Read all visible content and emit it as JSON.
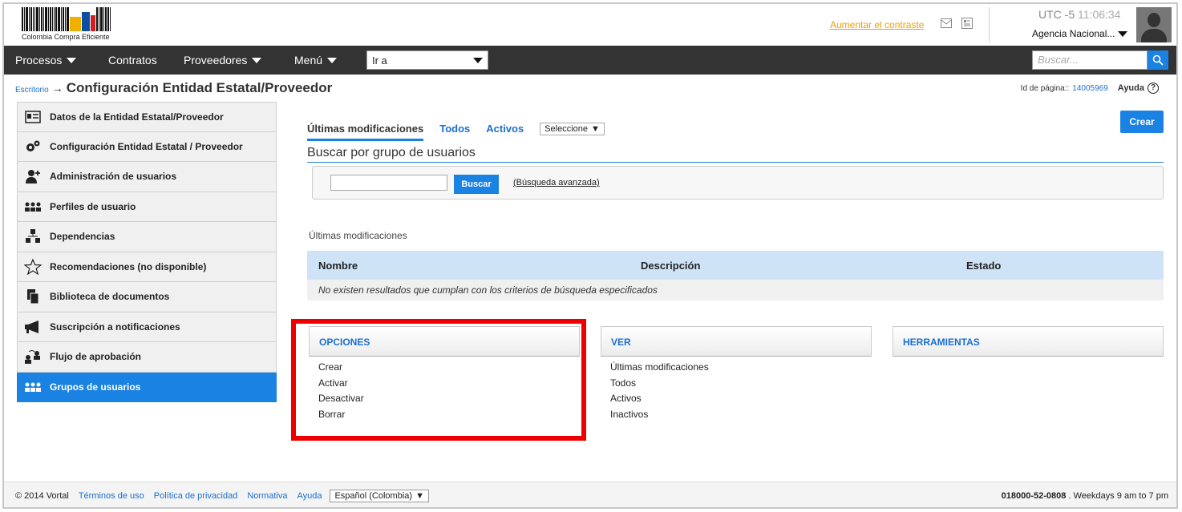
{
  "header": {
    "logo_text": "Colombia Compra Eficiente",
    "contrast_link": "Aumentar el contraste",
    "timezone": "UTC -5",
    "time": "11:06:34",
    "agency": "Agencia Nacional..."
  },
  "nav": {
    "items": [
      "Procesos",
      "Contratos",
      "Proveedores",
      "Menú"
    ],
    "goto_value": "Ir a",
    "search_placeholder": "Buscar..."
  },
  "breadcrumb": {
    "root": "Escritorio",
    "arrow": "→",
    "title": "Configuración Entidad Estatal/Proveedor"
  },
  "page_info": {
    "label": "Id de página::",
    "id": "14005969",
    "help": "Ayuda",
    "help_icon": "?"
  },
  "sidebar": {
    "items": [
      {
        "label": "Datos de la Entidad Estatal/Proveedor",
        "icon": "id-card-icon"
      },
      {
        "label": "Configuración Entidad Estatal / Proveedor",
        "icon": "gears-icon"
      },
      {
        "label": "Administración de usuarios",
        "icon": "user-add-icon"
      },
      {
        "label": "Perfiles de usuario",
        "icon": "users-icon"
      },
      {
        "label": "Dependencias",
        "icon": "org-chart-icon"
      },
      {
        "label": "Recomendaciones (no disponible)",
        "icon": "star-icon"
      },
      {
        "label": "Biblioteca de documentos",
        "icon": "documents-icon"
      },
      {
        "label": "Suscripción a notificaciones",
        "icon": "megaphone-icon"
      },
      {
        "label": "Flujo de aprobación",
        "icon": "approval-flow-icon"
      },
      {
        "label": "Grupos de usuarios",
        "icon": "group-icon",
        "active": true
      }
    ]
  },
  "tabs": {
    "items": [
      "Últimas modificaciones",
      "Todos",
      "Activos"
    ],
    "select_value": "Seleccione"
  },
  "create_button": "Crear",
  "search_group": {
    "title": "Buscar por grupo de usuarios",
    "input_value": "",
    "button": "Buscar",
    "advanced": "(Búsqueda avanzada)"
  },
  "results": {
    "section_label": "Últimas modificaciones",
    "columns": [
      "Nombre",
      "Descripción",
      "Estado"
    ],
    "empty_message": "No existen resultados que cumplan con los criterios de búsqueda especificados"
  },
  "panels": {
    "opciones": {
      "title": "OPCIONES",
      "items": [
        "Crear",
        "Activar",
        "Desactivar",
        "Borrar"
      ]
    },
    "ver": {
      "title": "VER",
      "items": [
        "Últimas modificaciones",
        "Todos",
        "Activos",
        "Inactivos"
      ]
    },
    "herramientas": {
      "title": "HERRAMIENTAS",
      "items": []
    }
  },
  "footer": {
    "copyright": "© 2014 Vortal",
    "links": [
      "Términos de uso",
      "Política de privacidad",
      "Normativa",
      "Ayuda"
    ],
    "language": "Español (Colombia)",
    "phone": "018000-52-0808",
    "hours": ". Weekdays 9 am to 7 pm"
  },
  "colors": {
    "accent": "#1a82e2",
    "navbar": "#333333",
    "highlight": "#ee0000",
    "contrast_link": "#f0a000"
  }
}
